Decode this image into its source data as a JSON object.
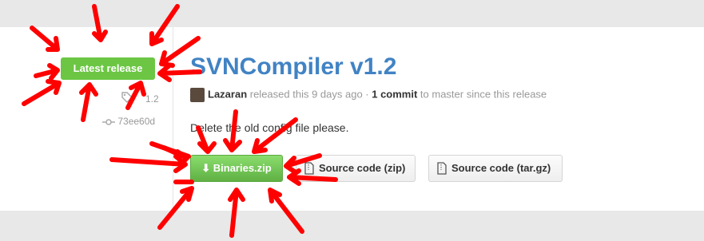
{
  "sidebar": {
    "latest_label": "Latest release",
    "tag_text": "1.2",
    "commit_hash": "73ee60d"
  },
  "release": {
    "title": "SVNCompiler v1.2",
    "author": "Lazaran",
    "released_text": " released this 9 days ago · ",
    "commit_link": "1 commit",
    "since_text": " to master since this release",
    "description": "Delete the old config file please."
  },
  "downloads": {
    "binaries_label": "⬇ Binaries.zip",
    "source_zip_label": "Source code (zip)",
    "source_tgz_label": "Source code (tar.gz)"
  },
  "colors": {
    "accent_green": "#6cc644",
    "link_blue": "#4183c4",
    "annotation_red": "#ff0000"
  }
}
